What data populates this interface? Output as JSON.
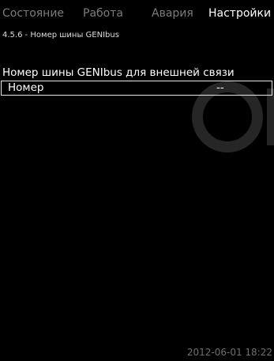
{
  "tabs": [
    {
      "label": "Состояние",
      "active": false
    },
    {
      "label": "Работа",
      "active": false
    },
    {
      "label": "Авария",
      "active": false
    },
    {
      "label": "Настройки",
      "active": true
    }
  ],
  "breadcrumb": "4.5.6 - Номер шины GENIbus",
  "section": {
    "title": "Номер шины GENIbus для внешней связи"
  },
  "parameter": {
    "label": "Номер",
    "value": "--"
  },
  "status": {
    "timestamp": "2012-06-01 18:22"
  },
  "colors": {
    "background": "#000000",
    "text": "#ffffff",
    "inactive_tab": "#7c7c7c",
    "watermark": "#262626"
  },
  "watermark_icon": "grundfos-logo-icon"
}
